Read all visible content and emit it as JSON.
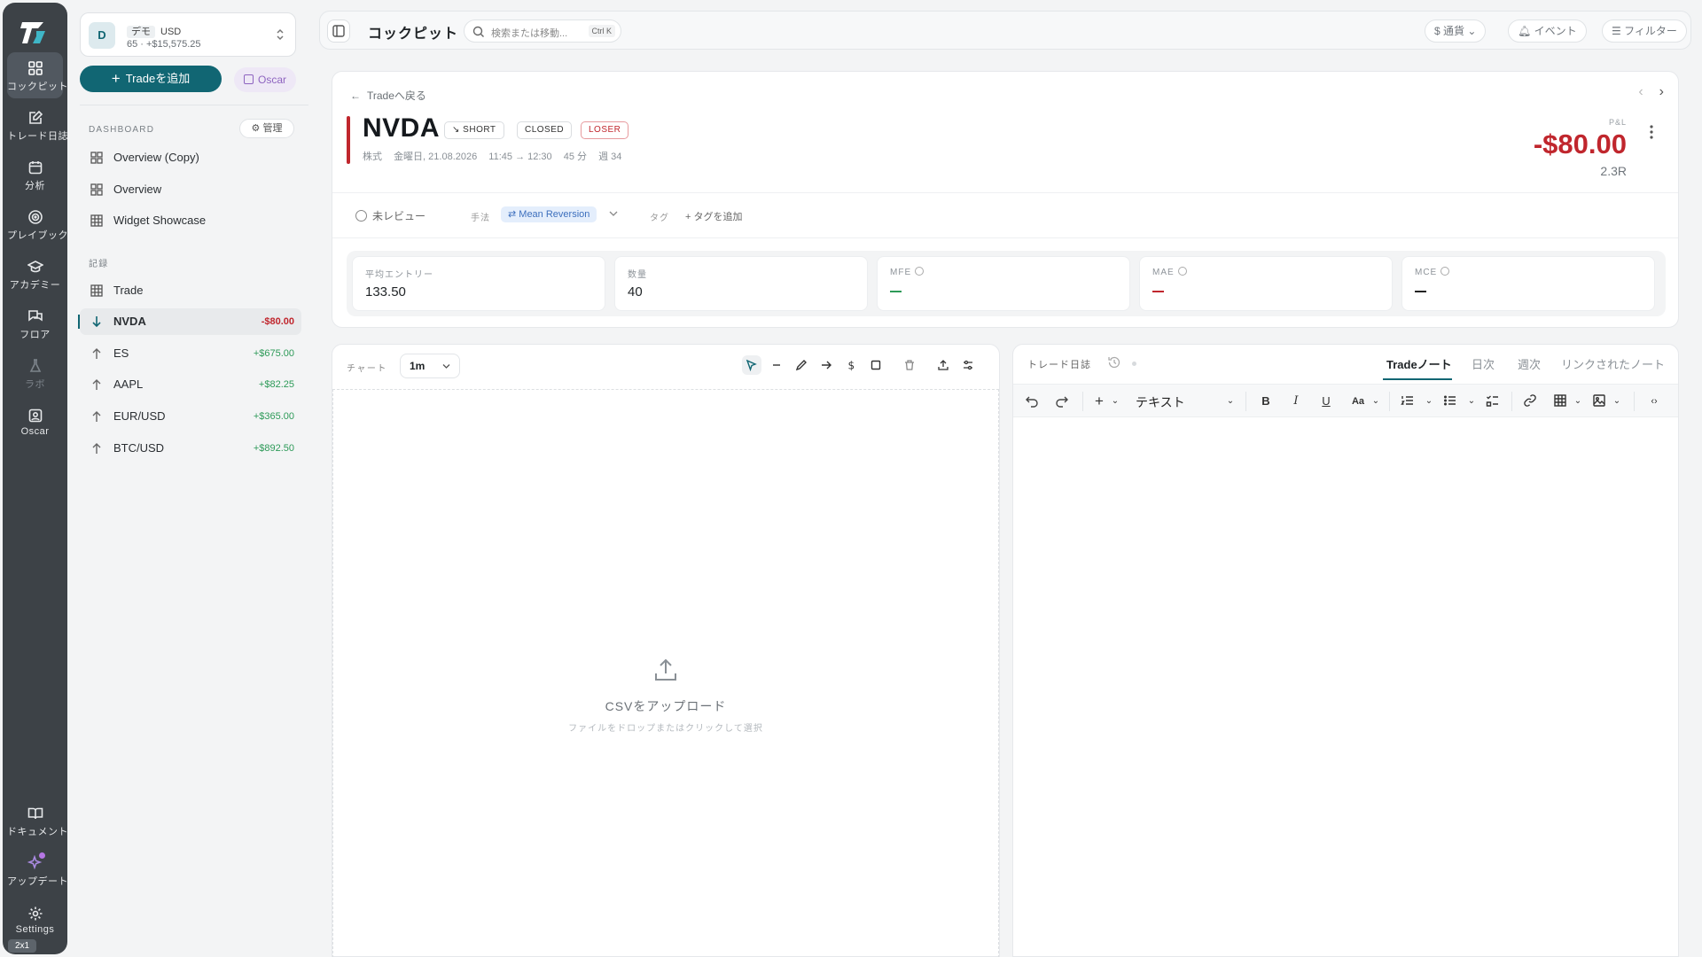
{
  "rail": {
    "items": [
      {
        "label": "コックピット"
      },
      {
        "label": "トレード日誌"
      },
      {
        "label": "分析"
      },
      {
        "label": "プレイブック"
      },
      {
        "label": "アカデミー"
      },
      {
        "label": "フロア"
      },
      {
        "label": "ラボ"
      },
      {
        "label": "Oscar"
      },
      {
        "label": "ドキュメント"
      },
      {
        "label": "アップデート"
      },
      {
        "label": "Settings"
      }
    ],
    "badge": "2x1"
  },
  "account": {
    "avatar": "D",
    "mode": "デモ",
    "currency": "USD",
    "summary": "65 · +$15,575.25"
  },
  "actions": {
    "add_trade": "Tradeを追加",
    "oscar": "Oscar"
  },
  "dashboard": {
    "section": "DASHBOARD",
    "manage": "管理",
    "items": [
      {
        "label": "Overview (Copy)"
      },
      {
        "label": "Overview"
      },
      {
        "label": "Widget Showcase"
      }
    ]
  },
  "records": {
    "section": "記録",
    "items": [
      {
        "label": "Trade",
        "value": ""
      },
      {
        "label": "NVDA",
        "value": "-$80.00"
      },
      {
        "label": "ES",
        "value": "+$675.00"
      },
      {
        "label": "AAPL",
        "value": "+$82.25"
      },
      {
        "label": "EUR/USD",
        "value": "+$365.00"
      },
      {
        "label": "BTC/USD",
        "value": "+$892.50"
      }
    ]
  },
  "topbar": {
    "title": "コックピット",
    "search_placeholder": "検索または移動...",
    "shortcut": "Ctrl K",
    "currency": "通貨",
    "events": "イベント",
    "filter": "フィルター"
  },
  "trade": {
    "back": "Tradeへ戻る",
    "symbol": "NVDA",
    "direction": "SHORT",
    "status": "CLOSED",
    "result": "LOSER",
    "asset": "株式",
    "date": "金曜日, 21.08.2026",
    "time": "11:45 → 12:30",
    "duration": "45 分",
    "week": "週 34",
    "pnl_label": "P&L",
    "pnl": "-$80.00",
    "r_multiple": "2.3R",
    "review": "未レビュー",
    "method_label": "手法",
    "method": "Mean Reversion",
    "tag_label": "タグ",
    "add_tag": "タグを追加",
    "metrics": [
      {
        "label": "平均エントリー",
        "value": "133.50"
      },
      {
        "label": "数量",
        "value": "40"
      },
      {
        "label": "MFE",
        "value": ""
      },
      {
        "label": "MAE",
        "value": ""
      },
      {
        "label": "MCE",
        "value": ""
      }
    ]
  },
  "chart": {
    "label": "チャート",
    "timeframe": "1m",
    "upload_title": "CSVをアップロード",
    "upload_hint": "ファイルをドロップまたはクリックして選択"
  },
  "notes": {
    "label": "トレード日誌",
    "tabs": [
      {
        "label": "Tradeノート"
      },
      {
        "label": "日次"
      },
      {
        "label": "週次"
      },
      {
        "label": "リンクされたノート"
      }
    ],
    "block_type": "テキスト"
  },
  "colors": {
    "accent": "#116673",
    "loss": "#c0262d",
    "profit": "#2d9a58"
  }
}
